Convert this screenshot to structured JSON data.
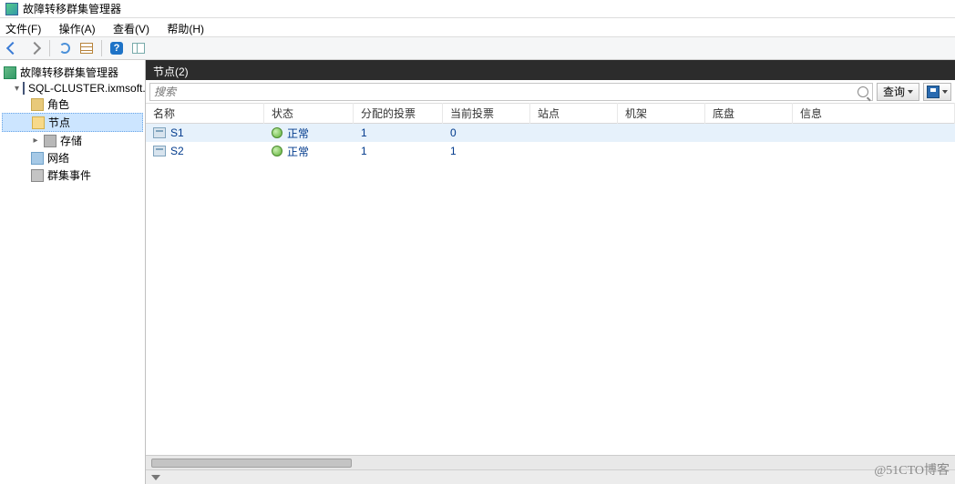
{
  "app_title": "故障转移群集管理器",
  "menus": {
    "file": "文件(F)",
    "action": "操作(A)",
    "view": "查看(V)",
    "help": "帮助(H)"
  },
  "tree": {
    "root": "故障转移群集管理器",
    "cluster": "SQL-CLUSTER.ixmsoft.com",
    "items": {
      "roles": "角色",
      "nodes": "节点",
      "storage": "存储",
      "networks": "网络",
      "events": "群集事件"
    }
  },
  "content": {
    "header": "节点(2)",
    "search_placeholder": "搜索",
    "query_btn": "查询",
    "columns": {
      "name": "名称",
      "status": "状态",
      "assigned_vote": "分配的投票",
      "current_vote": "当前投票",
      "site": "站点",
      "rack": "机架",
      "chassis": "底盘",
      "info": "信息"
    },
    "rows": [
      {
        "name": "S1",
        "status": "正常",
        "assigned_vote": "1",
        "current_vote": "0",
        "site": "",
        "rack": "",
        "chassis": "",
        "info": ""
      },
      {
        "name": "S2",
        "status": "正常",
        "assigned_vote": "1",
        "current_vote": "1",
        "site": "",
        "rack": "",
        "chassis": "",
        "info": ""
      }
    ]
  },
  "watermark": "@51CTO博客"
}
